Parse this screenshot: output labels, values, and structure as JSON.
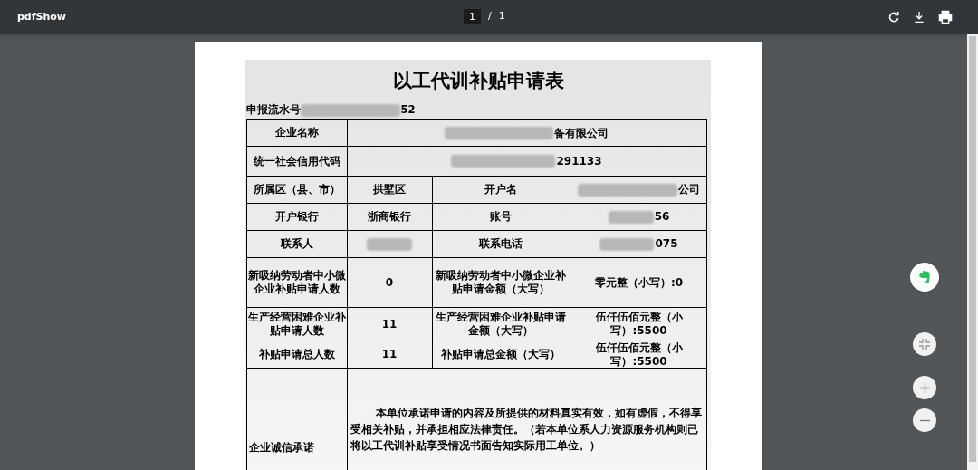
{
  "toolbar": {
    "title": "pdfShow",
    "page_current": "1",
    "page_separator": "/",
    "page_total": "1"
  },
  "document": {
    "title": "以工代训补贴申请表",
    "serial": {
      "label": "申报流水号",
      "text": "52",
      "redacted": true
    },
    "rows": [
      {
        "kind": "wide",
        "cells": [
          {
            "text": "企业名称"
          },
          {
            "text": "备有限公司",
            "redacted": true
          }
        ]
      },
      {
        "kind": "wide",
        "cells": [
          {
            "text": "统一社会信用代码"
          },
          {
            "text": "291133",
            "redacted": true
          }
        ]
      },
      {
        "kind": "quad",
        "cells": [
          {
            "text": "所属区（县、市）"
          },
          {
            "text": "拱墅区"
          },
          {
            "text": "开户名"
          },
          {
            "text": "公司",
            "redacted": true
          }
        ]
      },
      {
        "kind": "quad",
        "cells": [
          {
            "text": "开户银行"
          },
          {
            "text": "浙商银行"
          },
          {
            "text": "账号"
          },
          {
            "text": "56",
            "redacted": true
          }
        ]
      },
      {
        "kind": "quad",
        "cells": [
          {
            "text": "联系人"
          },
          {
            "redacted": true
          },
          {
            "text": "联系电话"
          },
          {
            "text": "075",
            "redacted": true
          }
        ]
      },
      {
        "kind": "quad",
        "cells": [
          {
            "text": "新吸纳劳动者中小微企业补贴申请人数"
          },
          {
            "text": "0"
          },
          {
            "text": "新吸纳劳动者中小微企业补贴申请金额（大写）"
          },
          {
            "text": "零元整（小写）:0"
          }
        ]
      },
      {
        "kind": "quad",
        "cells": [
          {
            "text": "生产经营困难企业补贴申请人数"
          },
          {
            "text": "11"
          },
          {
            "text": "生产经营困难企业补贴申请金额（大写）"
          },
          {
            "text": "伍仟伍佰元整（小写）:5500"
          }
        ]
      },
      {
        "kind": "quad",
        "cells": [
          {
            "text": "补贴申请总人数"
          },
          {
            "text": "11"
          },
          {
            "text": "补贴申请总金额（大写）"
          },
          {
            "text": "伍仟伍佰元整（小写）:5500"
          }
        ]
      },
      {
        "kind": "pledge",
        "cells": [
          {
            "text": "企业诚信承诺"
          },
          {
            "text": "本单位承诺申请的内容及所提供的材料真实有效，如有虚假，不得享受相关补贴，并承担相应法律责任。（若本单位系人力资源服务机构则已将以工代训补贴享受情况书面告知实际用工单位。）"
          }
        ]
      }
    ]
  }
}
